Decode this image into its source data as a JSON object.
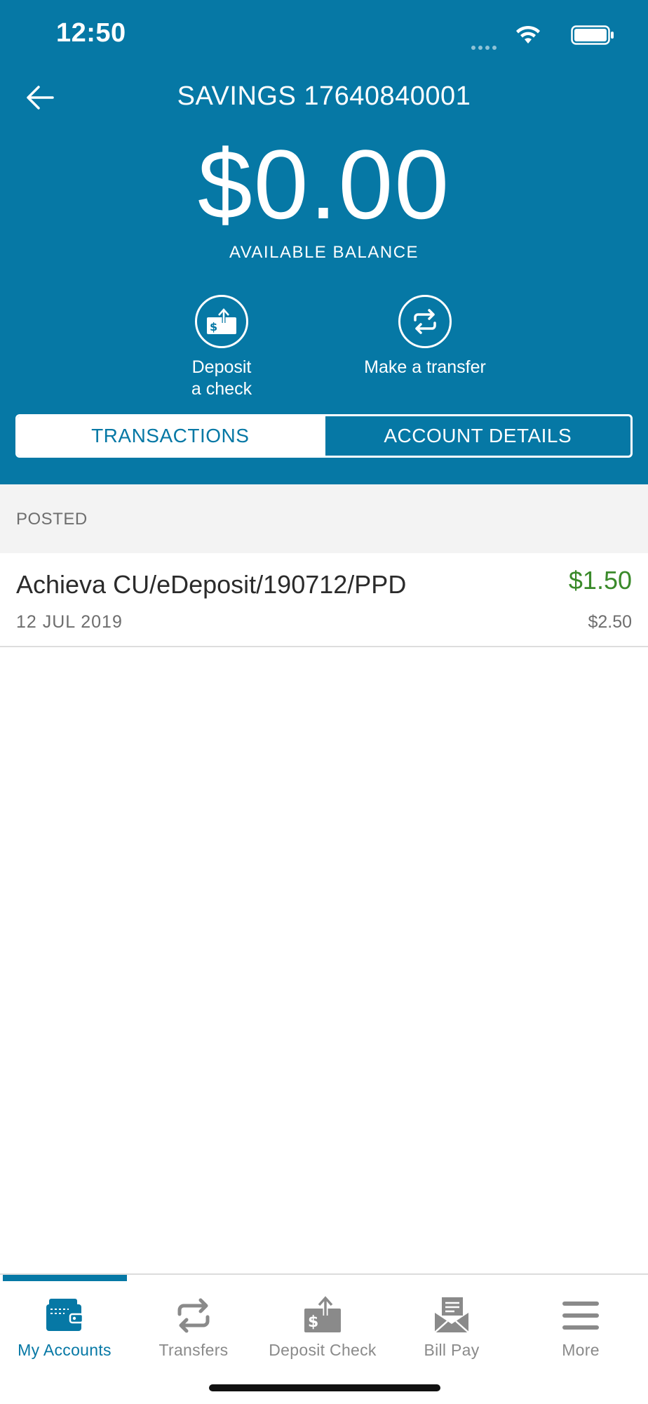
{
  "status_bar": {
    "time": "12:50"
  },
  "header": {
    "account_title": "SAVINGS 17640840001",
    "balance": "$0.00",
    "balance_label": "AVAILABLE BALANCE",
    "accent_color": "#0678a5"
  },
  "actions": [
    {
      "label_line1": "Deposit",
      "label_line2": "a check",
      "icon": "deposit-check-icon"
    },
    {
      "label": "Make a transfer",
      "icon": "transfer-icon"
    }
  ],
  "segments": [
    {
      "label": "TRANSACTIONS",
      "active": true
    },
    {
      "label": "ACCOUNT DETAILS",
      "active": false
    }
  ],
  "section": {
    "title": "POSTED"
  },
  "transactions": [
    {
      "description": "Achieva CU/eDeposit/190712/PPD",
      "date": "12 JUL 2019",
      "amount": "$1.50",
      "running_balance": "$2.50",
      "amount_color": "#3a8a2a"
    }
  ],
  "tabbar": {
    "items": [
      {
        "label": "My Accounts",
        "icon": "wallet-icon",
        "active": true
      },
      {
        "label": "Transfers",
        "icon": "transfer-icon",
        "active": false
      },
      {
        "label": "Deposit Check",
        "icon": "deposit-check-icon",
        "active": false
      },
      {
        "label": "Bill Pay",
        "icon": "bill-pay-icon",
        "active": false
      },
      {
        "label": "More",
        "icon": "menu-icon",
        "active": false
      }
    ]
  }
}
